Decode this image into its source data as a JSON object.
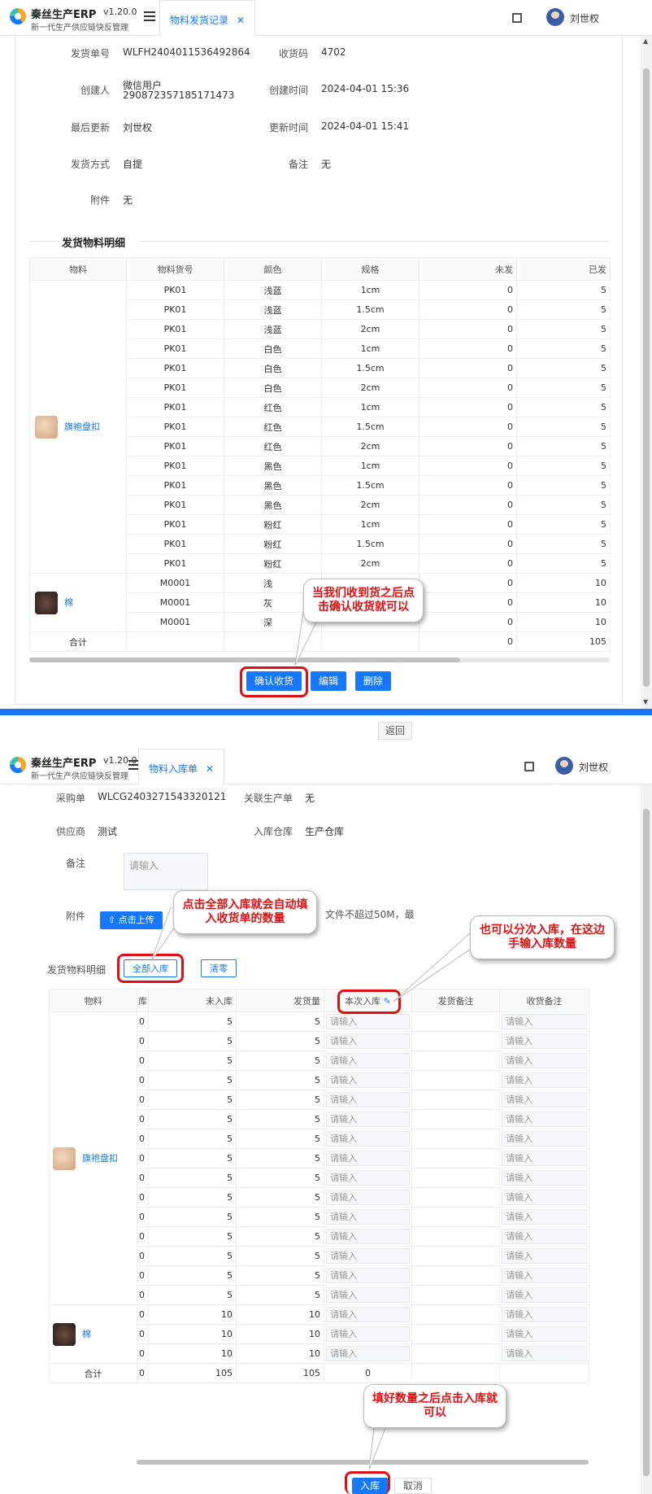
{
  "app": {
    "name": "秦丝生产ERP",
    "version": "v1.20.0",
    "subtitle": "新一代生产供应链快反管理",
    "user": "刘世权"
  },
  "shot1": {
    "tab_label": "物料发货记录",
    "fields": {
      "order_no_label": "发货单号",
      "order_no": "WLFH2404011536492864",
      "code_label": "收货码",
      "code": "4702",
      "creator_label": "创建人",
      "creator_line1": "微信用户",
      "creator_line2": "290872357185171473",
      "created_label": "创建时间",
      "created": "2024-04-01 15:36",
      "updater_label": "最后更新",
      "updater": "刘世权",
      "updated_label": "更新时间",
      "updated": "2024-04-01 15:41",
      "method_label": "发货方式",
      "method": "自提",
      "remark_label": "备注",
      "remark": "无",
      "attach_label": "附件",
      "attach": "无"
    },
    "section_title": "发货物料明细",
    "columns": [
      "物料",
      "物料货号",
      "颜色",
      "规格",
      "未发",
      "已发"
    ],
    "materials": [
      {
        "name": "旗袍盘扣",
        "rows": [
          [
            "PK01",
            "浅蓝",
            "1cm",
            "0",
            "5"
          ],
          [
            "PK01",
            "浅蓝",
            "1.5cm",
            "0",
            "5"
          ],
          [
            "PK01",
            "浅蓝",
            "2cm",
            "0",
            "5"
          ],
          [
            "PK01",
            "白色",
            "1cm",
            "0",
            "5"
          ],
          [
            "PK01",
            "白色",
            "1.5cm",
            "0",
            "5"
          ],
          [
            "PK01",
            "白色",
            "2cm",
            "0",
            "5"
          ],
          [
            "PK01",
            "红色",
            "1cm",
            "0",
            "5"
          ],
          [
            "PK01",
            "红色",
            "1.5cm",
            "0",
            "5"
          ],
          [
            "PK01",
            "红色",
            "2cm",
            "0",
            "5"
          ],
          [
            "PK01",
            "黑色",
            "1cm",
            "0",
            "5"
          ],
          [
            "PK01",
            "黑色",
            "1.5cm",
            "0",
            "5"
          ],
          [
            "PK01",
            "黑色",
            "2cm",
            "0",
            "5"
          ],
          [
            "PK01",
            "粉红",
            "1cm",
            "0",
            "5"
          ],
          [
            "PK01",
            "粉红",
            "1.5cm",
            "0",
            "5"
          ],
          [
            "PK01",
            "粉红",
            "2cm",
            "0",
            "5"
          ]
        ]
      },
      {
        "name": "棉",
        "rows": [
          [
            "M0001",
            "浅",
            "",
            "0",
            "10"
          ],
          [
            "M0001",
            "灰",
            "",
            "0",
            "10"
          ],
          [
            "M0001",
            "深",
            "",
            "0",
            "10"
          ]
        ]
      }
    ],
    "total_label": "合计",
    "total_unsent": "0",
    "total_sent": "105",
    "buttons": {
      "confirm": "确认收货",
      "edit": "编辑",
      "delete": "删除"
    },
    "callout": "当我们收到货之后点击确认收货就可以",
    "back_label": "返回"
  },
  "shot2": {
    "tab_label": "物料入库单",
    "fields": {
      "po_label": "采购单",
      "po": "WLCG2403271543320121",
      "prod_label": "关联生产单",
      "prod": "无",
      "supplier_label": "供应商",
      "supplier": "测试",
      "warehouse_label": "入库仓库",
      "warehouse": "生产仓库",
      "remark_label": "备注",
      "remark_placeholder": "请输入",
      "attach_label": "附件",
      "upload": "⇧ 点击上传",
      "attach_hint": "文件不超过50M，最"
    },
    "section_title": "发货物料明细",
    "btn_all_in": "全部入库",
    "btn_clear": "清零",
    "columns": [
      "物料",
      "库",
      "未入库",
      "发货量",
      "本次入库",
      "发货备注",
      "收货备注"
    ],
    "input_placeholder": "请输入",
    "materials": [
      {
        "name": "旗袍盘扣",
        "rows": [
          [
            "0",
            "5",
            "5"
          ],
          [
            "0",
            "5",
            "5"
          ],
          [
            "0",
            "5",
            "5"
          ],
          [
            "0",
            "5",
            "5"
          ],
          [
            "0",
            "5",
            "5"
          ],
          [
            "0",
            "5",
            "5"
          ],
          [
            "0",
            "5",
            "5"
          ],
          [
            "0",
            "5",
            "5"
          ],
          [
            "0",
            "5",
            "5"
          ],
          [
            "0",
            "5",
            "5"
          ],
          [
            "0",
            "5",
            "5"
          ],
          [
            "0",
            "5",
            "5"
          ],
          [
            "0",
            "5",
            "5"
          ],
          [
            "0",
            "5",
            "5"
          ],
          [
            "0",
            "5",
            "5"
          ]
        ]
      },
      {
        "name": "棉",
        "rows": [
          [
            "0",
            "10",
            "10"
          ],
          [
            "0",
            "10",
            "10"
          ],
          [
            "0",
            "10",
            "10"
          ]
        ]
      }
    ],
    "total_label": "合计",
    "total_a": "0",
    "total_b": "105",
    "total_c": "105",
    "total_d": "0",
    "btn_in": "入库",
    "btn_cancel": "取消",
    "callout_all": "点击全部入库就会自动填入收货单的数量",
    "callout_partial": "也可以分次入库，在这边手输入库数量",
    "callout_done": "填好数量之后点击入库就可以"
  }
}
